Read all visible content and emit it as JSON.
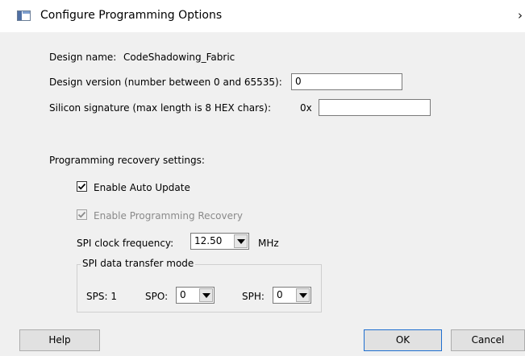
{
  "window": {
    "title": "Configure Programming Options",
    "close_glyph": "›"
  },
  "design": {
    "name_label": "Design name:",
    "name_value": "CodeShadowing_Fabric",
    "version_label": "Design version (number between 0 and 65535):",
    "version_value": "0",
    "signature_label": "Silicon signature (max length is 8 HEX chars):",
    "signature_prefix": "0x",
    "signature_value": ""
  },
  "recovery": {
    "heading": "Programming recovery settings:",
    "auto_update": {
      "label": "Enable Auto Update",
      "checked": true,
      "enabled": true
    },
    "programming_recovery": {
      "label": "Enable Programming Recovery",
      "checked": true,
      "enabled": false
    },
    "spi_clock_label": "SPI clock frequency:",
    "spi_clock_value": "12.50",
    "spi_clock_unit": "MHz"
  },
  "spi_mode": {
    "legend": "SPI data transfer mode",
    "sps_label": "SPS: 1",
    "spo_label": "SPO:",
    "spo_value": "0",
    "sph_label": "SPH:",
    "sph_value": "0"
  },
  "buttons": {
    "help": "Help",
    "ok": "OK",
    "cancel": "Cancel"
  },
  "icons": {
    "app": "dialog-window-icon",
    "close": "close-icon",
    "dropdown": "chevron-down-icon",
    "check": "checkmark-icon"
  }
}
